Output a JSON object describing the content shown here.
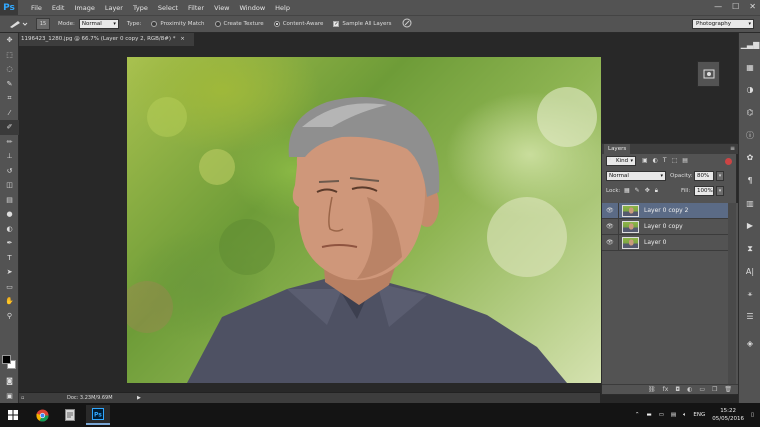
{
  "app": {
    "logo": "Ps"
  },
  "menu": [
    "File",
    "Edit",
    "Image",
    "Layer",
    "Type",
    "Select",
    "Filter",
    "View",
    "Window",
    "Help"
  ],
  "window_controls": {
    "minimize": "—",
    "maximize": "☐",
    "close": "✕"
  },
  "options_bar": {
    "brush_size": "15",
    "mode_label": "Mode:",
    "mode_value": "Normal",
    "type_label": "Type:",
    "type_options": [
      {
        "label": "Proximity Match",
        "selected": false
      },
      {
        "label": "Create Texture",
        "selected": false
      },
      {
        "label": "Content-Aware",
        "selected": true
      }
    ],
    "sample_all_layers": "Sample All Layers",
    "workspace": "Photography"
  },
  "document": {
    "tab_title": "1196423_1280.jpg @ 66.7% (Layer 0 copy 2, RGB/8#) *",
    "tab_close": "×",
    "status_doc": "Doc: 3.23M/9.69M",
    "status_arrow": "▶"
  },
  "layers_panel": {
    "title": "Layers",
    "kind": "Kind",
    "blend_mode": "Normal",
    "opacity_label": "Opacity:",
    "opacity": "80%",
    "lock_label": "Lock:",
    "fill_label": "Fill:",
    "fill": "100%",
    "layers": [
      {
        "name": "Layer 0 copy 2",
        "selected": true
      },
      {
        "name": "Layer 0 copy",
        "selected": false
      },
      {
        "name": "Layer 0",
        "selected": false
      }
    ]
  },
  "taskbar": {
    "tray_lang": "ENG",
    "time": "15:22",
    "date": "05/05/2016"
  },
  "colors": {
    "accent_selected": "#5b6b86",
    "ps_blue": "#31a8ff",
    "panel": "#535353",
    "canvas_bg": "#282828"
  }
}
